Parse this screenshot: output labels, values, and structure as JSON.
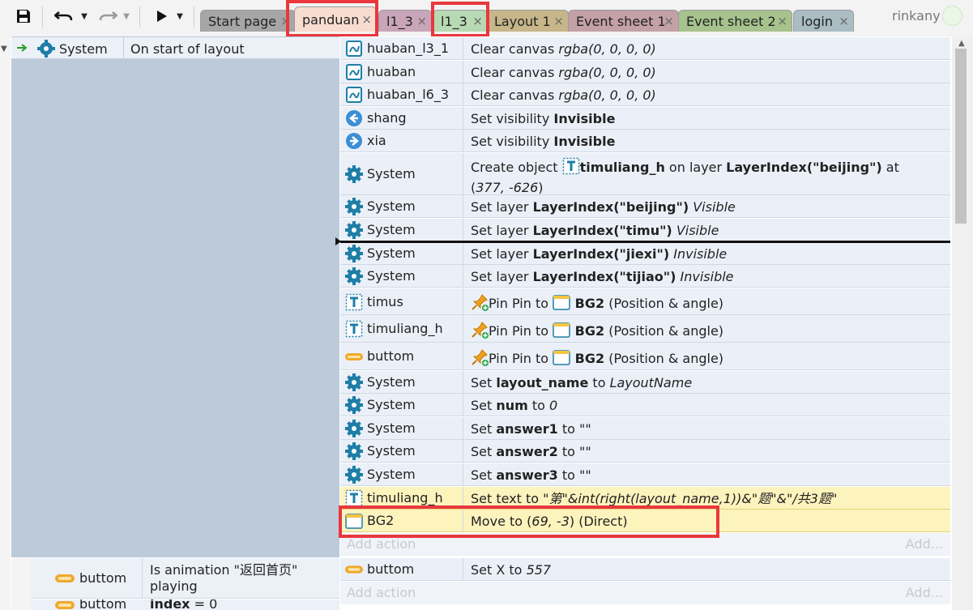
{
  "toolbar": {
    "save_icon": "floppy-disk-icon",
    "undo_icon": "undo-icon",
    "redo_icon": "redo-icon",
    "run_icon": "play-icon",
    "dropdown_icon": "chevron-down-icon"
  },
  "tabs": [
    {
      "label": "Start page",
      "color": "#a6a6a6",
      "active": false
    },
    {
      "label": "panduan",
      "color": "#f9dcd0",
      "active": true
    },
    {
      "label": "l1_3",
      "color": "#c9a5ba",
      "active": false
    },
    {
      "label": "l1_3",
      "color": "#b7d9b3",
      "active": false
    },
    {
      "label": "Layout 1",
      "color": "#c7b68a",
      "active": false
    },
    {
      "label": "Event sheet 1",
      "color": "#c4a0a7",
      "active": false
    },
    {
      "label": "Event sheet 2",
      "color": "#a6c28d",
      "active": false
    },
    {
      "label": "login",
      "color": "#a9bdc3",
      "active": false
    }
  ],
  "tab_close_glyph": "×",
  "user": {
    "name": "rinkany"
  },
  "event1": {
    "object": "System",
    "condition": "On start of layout"
  },
  "actions": [
    {
      "obj": "huaban_l3_1",
      "icon": "canvas-icon",
      "text": [
        {
          "t": "Clear canvas "
        },
        {
          "t": "rgba(0, 0, 0, 0)",
          "s": "i"
        }
      ]
    },
    {
      "obj": "huaban",
      "icon": "canvas-icon",
      "text": [
        {
          "t": "Clear canvas "
        },
        {
          "t": "rgba(0, 0, 0, 0)",
          "s": "i"
        }
      ]
    },
    {
      "obj": "huaban_l6_3",
      "icon": "canvas-icon",
      "text": [
        {
          "t": "Clear canvas "
        },
        {
          "t": "rgba(0, 0, 0, 0)",
          "s": "i"
        }
      ]
    },
    {
      "obj": "shang",
      "icon": "arrow-left-circle-icon",
      "text": [
        {
          "t": "Set visibility "
        },
        {
          "t": "Invisible",
          "s": "b"
        }
      ]
    },
    {
      "obj": "xia",
      "icon": "arrow-right-circle-icon",
      "text": [
        {
          "t": "Set visibility "
        },
        {
          "t": "Invisible",
          "s": "b"
        }
      ]
    },
    {
      "obj": "System",
      "icon": "gear-icon",
      "text": [
        {
          "t": "Create object "
        },
        {
          "icon": "text-object-icon"
        },
        {
          "t": "timuliang_h",
          "s": "b"
        },
        {
          "t": " on layer "
        },
        {
          "t": "LayerIndex(\"beijing\")",
          "s": "b"
        },
        {
          "t": " at ("
        },
        {
          "t": "377, -626",
          "s": "i"
        },
        {
          "t": ")"
        }
      ]
    },
    {
      "obj": "System",
      "icon": "gear-icon",
      "text": [
        {
          "t": "Set layer "
        },
        {
          "t": "LayerIndex(\"beijing\")",
          "s": "b"
        },
        {
          "t": " "
        },
        {
          "t": "Visible",
          "s": "i"
        }
      ]
    },
    {
      "obj": "System",
      "icon": "gear-icon",
      "text": [
        {
          "t": "Set layer "
        },
        {
          "t": "LayerIndex(\"timu\")",
          "s": "b"
        },
        {
          "t": " "
        },
        {
          "t": "Visible",
          "s": "i"
        }
      ]
    },
    {
      "obj": "System",
      "icon": "gear-icon",
      "text": [
        {
          "t": "Set layer "
        },
        {
          "t": "LayerIndex(\"jiexi\")",
          "s": "b"
        },
        {
          "t": " "
        },
        {
          "t": "Invisible",
          "s": "i"
        }
      ]
    },
    {
      "obj": "System",
      "icon": "gear-icon",
      "text": [
        {
          "t": "Set layer "
        },
        {
          "t": "LayerIndex(\"tijiao\")",
          "s": "b"
        },
        {
          "t": " "
        },
        {
          "t": "Invisible",
          "s": "i"
        }
      ]
    },
    {
      "obj": "timus",
      "icon": "text-object-icon",
      "text": [
        {
          "icon": "pin-icon"
        },
        {
          "t": "Pin Pin to "
        },
        {
          "icon": "sprite-icon"
        },
        {
          "t": " BG2",
          "s": "b"
        },
        {
          "t": " (Position & angle)"
        }
      ]
    },
    {
      "obj": "timuliang_h",
      "icon": "text-object-icon",
      "text": [
        {
          "icon": "pin-icon"
        },
        {
          "t": "Pin Pin to "
        },
        {
          "icon": "sprite-icon"
        },
        {
          "t": " BG2",
          "s": "b"
        },
        {
          "t": " (Position & angle)"
        }
      ]
    },
    {
      "obj": "buttom",
      "icon": "button-sprite-icon",
      "text": [
        {
          "icon": "pin-icon"
        },
        {
          "t": "Pin Pin to "
        },
        {
          "icon": "sprite-icon"
        },
        {
          "t": " BG2",
          "s": "b"
        },
        {
          "t": " (Position & angle)"
        }
      ]
    },
    {
      "obj": "System",
      "icon": "gear-icon",
      "text": [
        {
          "t": "Set "
        },
        {
          "t": "layout_name",
          "s": "b"
        },
        {
          "t": " to "
        },
        {
          "t": "LayoutName",
          "s": "i"
        }
      ]
    },
    {
      "obj": "System",
      "icon": "gear-icon",
      "text": [
        {
          "t": "Set "
        },
        {
          "t": "num",
          "s": "b"
        },
        {
          "t": " to "
        },
        {
          "t": "0",
          "s": "i"
        }
      ]
    },
    {
      "obj": "System",
      "icon": "gear-icon",
      "text": [
        {
          "t": "Set "
        },
        {
          "t": "answer1",
          "s": "b"
        },
        {
          "t": " to "
        },
        {
          "t": "\"\"",
          "s": "i"
        }
      ]
    },
    {
      "obj": "System",
      "icon": "gear-icon",
      "text": [
        {
          "t": "Set "
        },
        {
          "t": "answer2",
          "s": "b"
        },
        {
          "t": " to "
        },
        {
          "t": "\"\"",
          "s": "i"
        }
      ]
    },
    {
      "obj": "System",
      "icon": "gear-icon",
      "text": [
        {
          "t": "Set "
        },
        {
          "t": "answer3",
          "s": "b"
        },
        {
          "t": " to "
        },
        {
          "t": "\"\"",
          "s": "i"
        }
      ]
    },
    {
      "obj": "timuliang_h",
      "icon": "text-object-icon",
      "highlight": true,
      "text": [
        {
          "t": "Set text to "
        },
        {
          "t": "\"第\"&int(right(layout_name,1))&\"题\"&\"/共3题\"",
          "s": "i"
        }
      ]
    },
    {
      "obj": "BG2",
      "icon": "sprite-icon",
      "highlight": true,
      "text": [
        {
          "t": "Move to ("
        },
        {
          "t": "69, -3",
          "s": "i"
        },
        {
          "t": ") (Direct)"
        }
      ]
    }
  ],
  "add_action": {
    "label": "Add action",
    "right": "Add..."
  },
  "event2": {
    "conditions": [
      {
        "obj": "buttom",
        "icon": "button-sprite-icon",
        "text": "Is animation \"返回首页\" playing"
      },
      {
        "obj": "buttom",
        "icon": "button-sprite-icon",
        "text_prefix": "index",
        "text": " = 0"
      }
    ],
    "actions": [
      {
        "obj": "buttom",
        "icon": "button-sprite-icon",
        "text": [
          {
            "t": "Set X to "
          },
          {
            "t": "557",
            "s": "i"
          }
        ]
      }
    ]
  },
  "colors": {
    "annotation_red": "#e8383d",
    "highlight_row": "#fdf3bd",
    "event_block": "#bccad9"
  }
}
